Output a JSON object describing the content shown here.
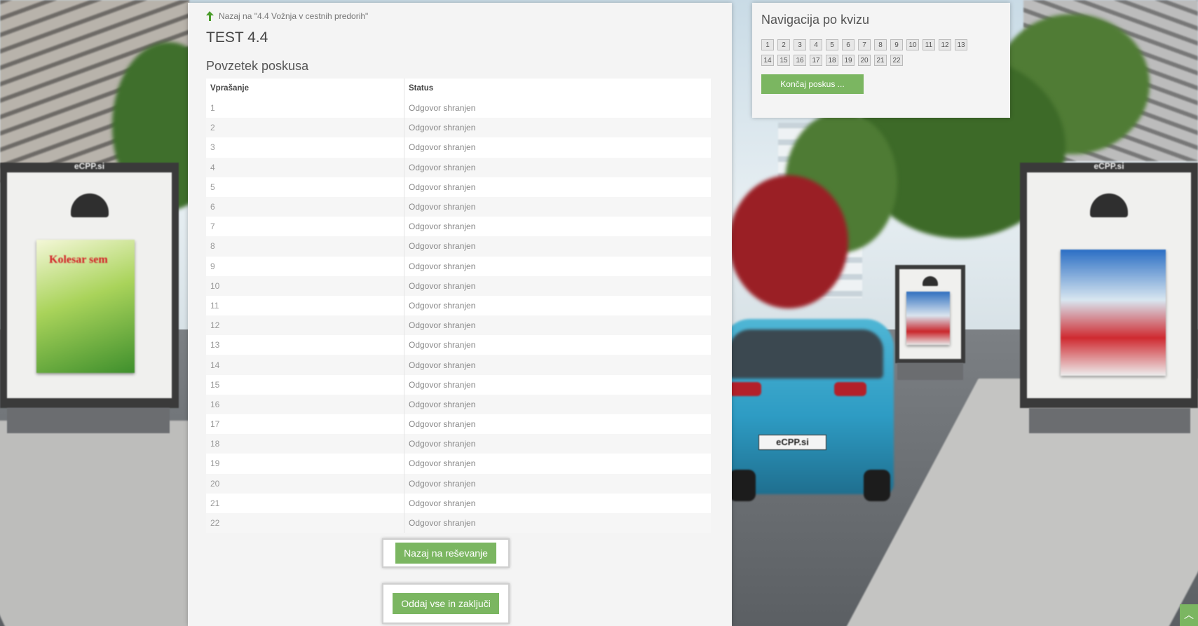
{
  "back_link": "Nazaj na \"4.4 Vožnja v cestnih predorih\"",
  "page_title": "TEST 4.4",
  "section_title": "Povzetek poskusa",
  "table": {
    "headers": [
      "Vprašanje",
      "Status"
    ],
    "rows": [
      {
        "q": "1",
        "status": "Odgovor shranjen"
      },
      {
        "q": "2",
        "status": "Odgovor shranjen"
      },
      {
        "q": "3",
        "status": "Odgovor shranjen"
      },
      {
        "q": "4",
        "status": "Odgovor shranjen"
      },
      {
        "q": "5",
        "status": "Odgovor shranjen"
      },
      {
        "q": "6",
        "status": "Odgovor shranjen"
      },
      {
        "q": "7",
        "status": "Odgovor shranjen"
      },
      {
        "q": "8",
        "status": "Odgovor shranjen"
      },
      {
        "q": "9",
        "status": "Odgovor shranjen"
      },
      {
        "q": "10",
        "status": "Odgovor shranjen"
      },
      {
        "q": "11",
        "status": "Odgovor shranjen"
      },
      {
        "q": "12",
        "status": "Odgovor shranjen"
      },
      {
        "q": "13",
        "status": "Odgovor shranjen"
      },
      {
        "q": "14",
        "status": "Odgovor shranjen"
      },
      {
        "q": "15",
        "status": "Odgovor shranjen"
      },
      {
        "q": "16",
        "status": "Odgovor shranjen"
      },
      {
        "q": "17",
        "status": "Odgovor shranjen"
      },
      {
        "q": "18",
        "status": "Odgovor shranjen"
      },
      {
        "q": "19",
        "status": "Odgovor shranjen"
      },
      {
        "q": "20",
        "status": "Odgovor shranjen"
      },
      {
        "q": "21",
        "status": "Odgovor shranjen"
      },
      {
        "q": "22",
        "status": "Odgovor shranjen"
      }
    ]
  },
  "buttons": {
    "back_to_solving": "Nazaj na reševanje",
    "submit_all": "Oddaj vse in zaključi"
  },
  "nav": {
    "title": "Navigacija po kvizu",
    "questions": [
      "1",
      "2",
      "3",
      "4",
      "5",
      "6",
      "7",
      "8",
      "9",
      "10",
      "11",
      "12",
      "13",
      "14",
      "15",
      "16",
      "17",
      "18",
      "19",
      "20",
      "21",
      "22"
    ],
    "finish_label": "Končaj poskus ..."
  },
  "scene": {
    "billboard_brand": "eCPP.si",
    "left_poster_title": "Kolesar sem",
    "plate": "eCPP.si"
  },
  "colors": {
    "accent_green": "#7bb661",
    "panel_bg": "#f4f4f4"
  }
}
